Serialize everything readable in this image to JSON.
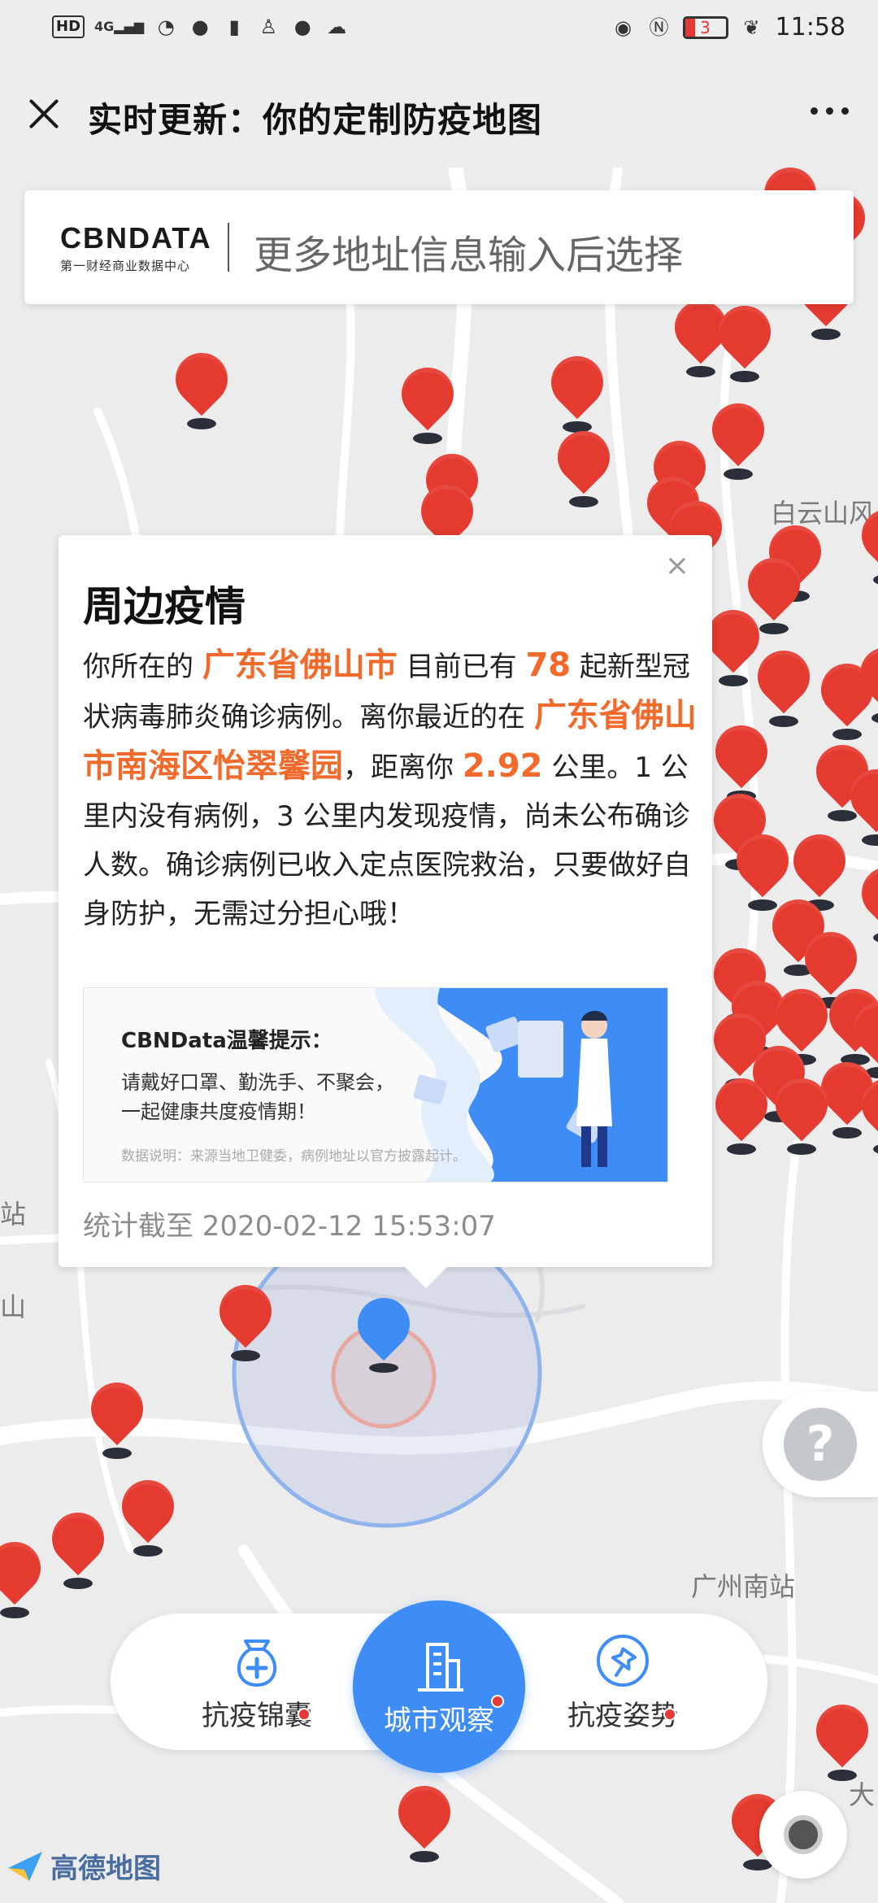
{
  "status_bar": {
    "left_icons": [
      "hd-icon",
      "signal-4g-icon",
      "wifi-icon",
      "notification-icon",
      "sim-icon",
      "qq-icon",
      "chat-icon",
      "weather-icon"
    ],
    "hd_label": "HD",
    "network_label": "4G",
    "battery_level": "3",
    "time": "11:58"
  },
  "title_bar": {
    "title": "实时更新：你的定制防疫地图"
  },
  "search": {
    "logo_main": "CBNDATA",
    "logo_sub": "第一财经商业数据中心",
    "placeholder": "更多地址信息输入后选择"
  },
  "map": {
    "labels": [
      "白云山风",
      "站",
      "山",
      "广州南站",
      "大"
    ]
  },
  "popup": {
    "close_symbol": "×",
    "title": "周边疫情",
    "seg1": "你所在的",
    "city": "广东省佛山市",
    "seg2": "目前已有",
    "count": "78",
    "seg3": "起新型冠状病毒肺炎确诊病例。离你最近的在",
    "nearest": "广东省佛山市南海区怡翠馨园",
    "seg4": "，距离你",
    "distance": "2.92",
    "seg5": "公里。1 公里内没有病例，3 公里内发现疫情，尚未公布确诊人数。确诊病例已收入定点医院救治，只要做好自身防护，无需过分担心哦！",
    "banner_title": "CBNData温馨提示：",
    "banner_line1": "请戴好口罩、勤洗手、不聚会，",
    "banner_line2": "一起健康共度疫情期！",
    "banner_note": "数据说明：来源当地卫健委，病例地址以官方披露起计。",
    "stat_time": "统计截至 2020-02-12 15:53:07"
  },
  "help": {
    "symbol": "?"
  },
  "bottom_nav": {
    "left_label": "抗疫锦囊",
    "center_label": "城市观察",
    "right_label": "抗疫姿势"
  },
  "amap": {
    "brand": "高德地图"
  },
  "colors": {
    "accent_blue": "#3e8cf5",
    "pin_red": "#e53a2f",
    "highlight_orange": "#f26a2b"
  }
}
